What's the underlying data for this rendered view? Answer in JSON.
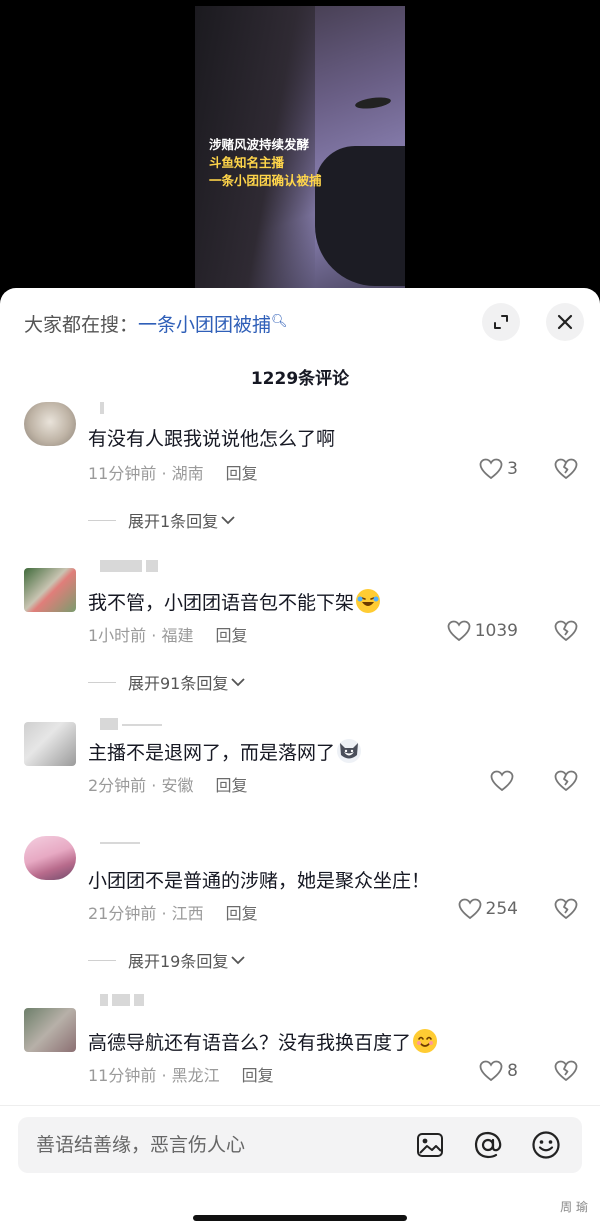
{
  "video": {
    "caption_lines": [
      "涉赌风波持续发酵",
      "斗鱼知名主播",
      "一条小团团确认被捕"
    ]
  },
  "header": {
    "search_prefix": "大家都在搜：",
    "search_term": "一条小团团被捕",
    "comment_count": "1229条评论"
  },
  "comments": [
    {
      "text": "有没有人跟我说说他怎么了啊",
      "time": "11分钟前",
      "location": "湖南",
      "reply": "回复",
      "likes": "3",
      "expand": "展开1条回复"
    },
    {
      "text": "我不管，小团团语音包不能下架",
      "time": "1小时前",
      "location": "福建",
      "reply": "回复",
      "likes": "1039",
      "expand": "展开91条回复"
    },
    {
      "text": "主播不是退网了，而是落网了",
      "time": "2分钟前",
      "location": "安徽",
      "reply": "回复",
      "likes": "",
      "expand": ""
    },
    {
      "text": "小团团不是普通的涉赌，她是聚众坐庄！",
      "time": "21分钟前",
      "location": "江西",
      "reply": "回复",
      "likes": "254",
      "expand": "展开19条回复"
    },
    {
      "text": "高德导航还有语音么？没有我换百度了",
      "time": "11分钟前",
      "location": "黑龙江",
      "reply": "回复",
      "likes": "8",
      "expand": ""
    }
  ],
  "input": {
    "placeholder": "善语结善缘，恶言伤人心"
  },
  "watermark": "周  瑜",
  "colors": {
    "link": "#2f5fb8",
    "caption_highlight": "#ffd54a"
  }
}
